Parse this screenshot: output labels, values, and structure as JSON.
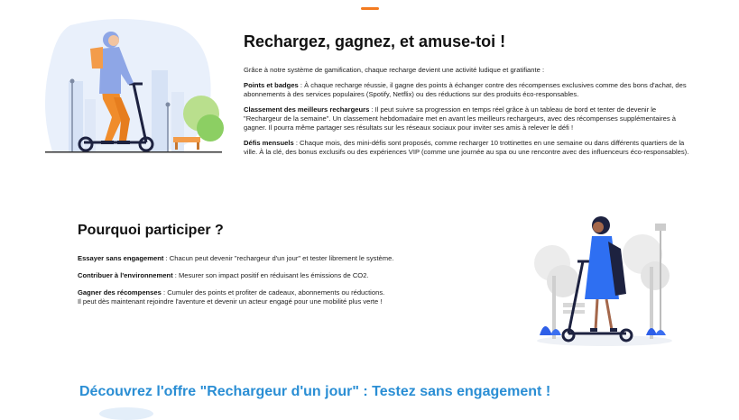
{
  "colors": {
    "accent": "#f47b20",
    "cta": "#2a8ed4",
    "text": "#111111"
  },
  "illustrations": [
    "man-on-scooter-illustration",
    "woman-on-scooter-illustration"
  ],
  "gamification": {
    "title": "Rechargez, gagnez, et amuse-toi !",
    "intro": "Grâce à notre système de gamification, chaque recharge devient une activité ludique et gratifiante :",
    "items": [
      {
        "label": "Points et badges",
        "text": " : À chaque recharge réussie, il gagne des points à échanger contre des récompenses exclusives comme des bons d'achat, des abonnements à des services populaires (Spotify, Netflix) ou des réductions sur des produits éco-responsables."
      },
      {
        "label": "Classement des meilleurs rechargeurs",
        "text": " : Il peut suivre sa progression en temps réel grâce à un tableau de bord et tenter de devenir le \"Rechargeur de la semaine\". Un classement hebdomadaire met en avant les meilleurs rechargeurs, avec des récompenses supplémentaires à gagner. Il pourra même partager ses résultats sur les réseaux sociaux pour inviter ses amis à relever le défi !"
      },
      {
        "label": "Défis mensuels",
        "text": " : Chaque mois, des mini-défis sont proposés, comme recharger 10 trottinettes en une semaine ou dans différents quartiers de la ville. À la clé, des bonus exclusifs ou des expériences VIP (comme une journée au spa ou une rencontre avec des influenceurs éco-responsables)."
      }
    ]
  },
  "why": {
    "title": "Pourquoi participer ?",
    "items": [
      {
        "label": "Essayer sans engagement",
        "text": " : Chacun peut devenir \"rechargeur d'un jour\" et tester librement le système."
      },
      {
        "label": "Contribuer à l'environnement",
        "text": " : Mesurer son impact positif en réduisant les émissions de CO2."
      },
      {
        "label": "Gagner des récompenses",
        "text": " : Cumuler des points et profiter de cadeaux, abonnements ou réductions."
      }
    ],
    "closing": "Il peut dès maintenant rejoindre l'aventure et devenir un acteur engagé pour une mobilité plus verte !"
  },
  "cta": {
    "text": "Découvrez l'offre \"Rechargeur d'un jour\" : Testez sans engagement !"
  }
}
